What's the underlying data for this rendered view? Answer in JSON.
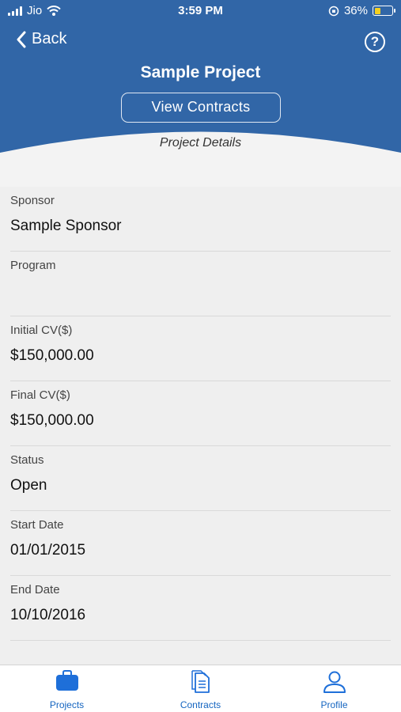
{
  "status_bar": {
    "carrier": "Jio",
    "time": "3:59 PM",
    "battery": "36%",
    "battery_level": 0.36
  },
  "header": {
    "back_label": "Back",
    "help_label": "?",
    "title": "Sample Project",
    "view_contracts_label": "View Contracts",
    "subtitle": "Project Details"
  },
  "details": [
    {
      "label": "Sponsor",
      "value": "Sample Sponsor"
    },
    {
      "label": "Program",
      "value": ""
    },
    {
      "label": "Initial CV($)",
      "value": "$150,000.00"
    },
    {
      "label": "Final CV($)",
      "value": "$150,000.00"
    },
    {
      "label": "Status",
      "value": "Open"
    },
    {
      "label": "Start Date",
      "value": "01/01/2015"
    },
    {
      "label": "End Date",
      "value": "10/10/2016"
    }
  ],
  "tabs": [
    {
      "label": "Projects",
      "icon": "briefcase-icon",
      "active": true
    },
    {
      "label": "Contracts",
      "icon": "document-icon",
      "active": false
    },
    {
      "label": "Profile",
      "icon": "user-icon",
      "active": false
    }
  ],
  "colors": {
    "header_blue": "#3166a7",
    "accent_blue": "#1565c0"
  }
}
